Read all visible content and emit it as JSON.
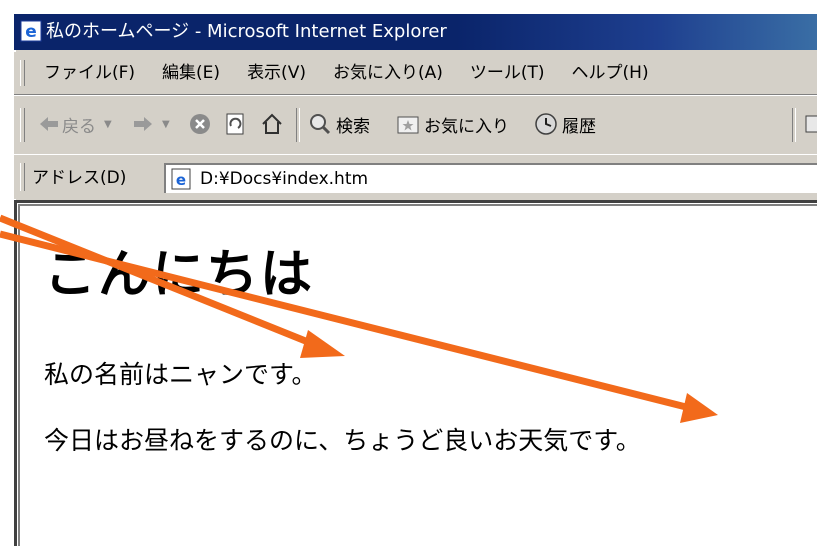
{
  "window": {
    "title": "私のホームページ - Microsoft Internet Explorer"
  },
  "menubar": {
    "items": [
      {
        "label": "ファイル(F)"
      },
      {
        "label": "編集(E)"
      },
      {
        "label": "表示(V)"
      },
      {
        "label": "お気に入り(A)"
      },
      {
        "label": "ツール(T)"
      },
      {
        "label": "ヘルプ(H)"
      }
    ]
  },
  "toolbar": {
    "back_label": "戻る",
    "search_label": "検索",
    "favorites_label": "お気に入り",
    "history_label": "履歴"
  },
  "address": {
    "label": "アドレス(D)",
    "value": "D:¥Docs¥index.htm"
  },
  "page": {
    "heading": "こんにちは",
    "paragraph1": "私の名前はニャンです。",
    "paragraph2": "今日はお昼ねをするのに、ちょうど良いお天気です。"
  },
  "colors": {
    "titlebar": "#0a246a",
    "chrome": "#d4d0c8",
    "annotation_arrow": "#f26a1b"
  },
  "icons": [
    "ie-icon",
    "back-arrow-icon",
    "forward-arrow-icon",
    "stop-icon",
    "refresh-icon",
    "home-icon",
    "search-icon",
    "favorites-icon",
    "history-icon",
    "mail-icon",
    "page-icon"
  ]
}
